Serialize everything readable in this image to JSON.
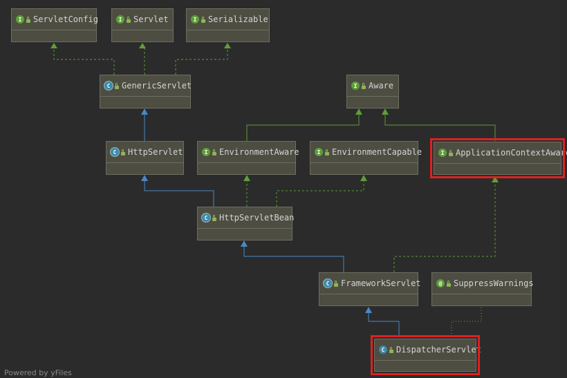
{
  "diagram": {
    "nodes": {
      "servlet_config": {
        "label": "ServletConfig",
        "kind": "I"
      },
      "servlet": {
        "label": "Servlet",
        "kind": "I"
      },
      "serializable": {
        "label": "Serializable",
        "kind": "I"
      },
      "generic_servlet": {
        "label": "GenericServlet",
        "kind": "C"
      },
      "aware": {
        "label": "Aware",
        "kind": "I"
      },
      "http_servlet": {
        "label": "HttpServlet",
        "kind": "C"
      },
      "environment_aware": {
        "label": "EnvironmentAware",
        "kind": "I"
      },
      "environment_capable": {
        "label": "EnvironmentCapable",
        "kind": "I"
      },
      "application_context_aware": {
        "label": "ApplicationContextAware",
        "kind": "I"
      },
      "http_servlet_bean": {
        "label": "HttpServletBean",
        "kind": "C"
      },
      "framework_servlet": {
        "label": "FrameworkServlet",
        "kind": "C"
      },
      "suppress_warnings": {
        "label": "SuppressWarnings",
        "kind": "@"
      },
      "dispatcher_servlet": {
        "label": "DispatcherServlet",
        "kind": "C"
      }
    },
    "colors": {
      "extends_edge": "#4a88c7",
      "implements_edge": "#5f9e3a",
      "annotation_edge": "#9b9b2a",
      "highlight": "#e02020"
    }
  },
  "footer": {
    "text": "Powered by yFiles"
  }
}
